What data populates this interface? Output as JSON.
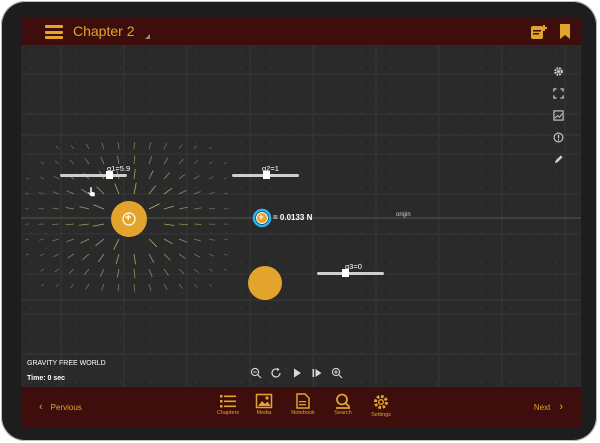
{
  "header": {
    "title": "Chapter 2"
  },
  "sliders": [
    {
      "label": "q1=5.9"
    },
    {
      "label": "q2=1"
    },
    {
      "label": "q3=0"
    }
  ],
  "charges": {
    "q1_symbol": "+",
    "q2_symbol": "+"
  },
  "force_readout": "= 0.0133 N",
  "origin_label": "origin",
  "world_label": "GRAVITY FREE WORLD",
  "time_label": "Time: 0 sec",
  "footer": {
    "prev": "Pervious",
    "next": "Next",
    "items": [
      {
        "label": "Chapters"
      },
      {
        "label": "Media"
      },
      {
        "label": "Notebook"
      },
      {
        "label": "Search"
      },
      {
        "label": "Settings"
      }
    ]
  },
  "colors": {
    "accent": "#e2a42c",
    "bar": "#3d0e0c",
    "charge": "#e2a42c",
    "highlight": "#29b6f6"
  },
  "icons": [
    "menu-icon",
    "add-note-icon",
    "bookmark-icon",
    "gear-icon",
    "fullscreen-icon",
    "image-icon",
    "info-icon",
    "pencil-icon",
    "zoom-out-icon",
    "reset-icon",
    "play-icon",
    "step-icon",
    "zoom-in-icon",
    "chapters-icon",
    "media-icon",
    "notebook-icon",
    "search-icon",
    "settings-icon"
  ]
}
